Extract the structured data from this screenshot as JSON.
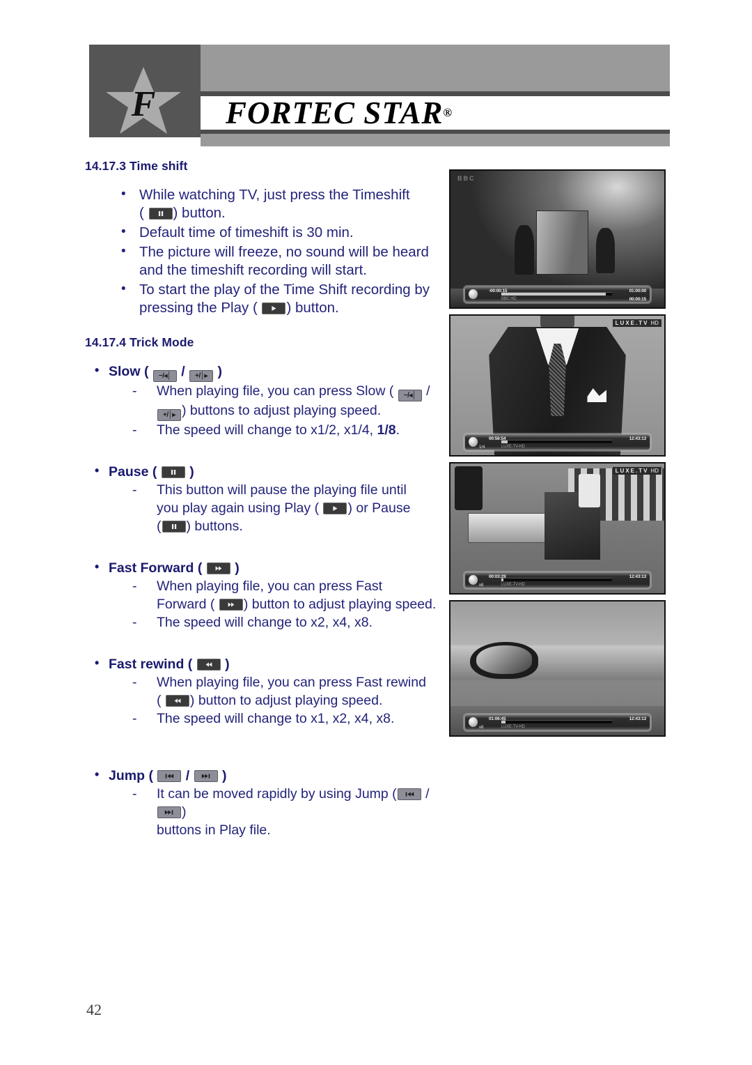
{
  "header": {
    "brand": "FORTEC STAR",
    "registered_mark": "®",
    "logo_letter": "F"
  },
  "sections": [
    {
      "number": "14.17.3",
      "title": "Time shift",
      "heading": "14.17.3 Time shift"
    },
    {
      "number": "14.17.4",
      "title": "Trick Mode",
      "heading": "14.17.4 Trick Mode"
    }
  ],
  "timeshift_bullets": {
    "b1_a": "While watching TV, just press the Timeshift",
    "b1_b1": "(",
    "b1_b2": ") button.",
    "b2": "Default time of timeshift is 30 min.",
    "b3_a": "The picture will freeze, no sound will be heard",
    "b3_b": "and the timeshift recording will start.",
    "b4_a": "To start the play of the Time Shift recording by",
    "b4_b1": "pressing the Play (",
    "b4_b2": ") button."
  },
  "trick": {
    "slow": {
      "label": "Slow",
      "paren_open": "(",
      "slash": "/",
      "paren_close": ")",
      "d1_a": "When playing file, you can press Slow (",
      "d1_slash": "/",
      "d1_b": ") buttons to adjust playing speed.",
      "d2_a": "The speed will change to x1/2, x1/4, ",
      "d2_bold": "1/8",
      "d2_b": "."
    },
    "pause": {
      "label": "Pause",
      "paren_open": "(",
      "paren_close": ")",
      "d1_a": "This button will pause the playing file until",
      "d1_b1": "you play again using Play (",
      "d1_b2": ") or Pause",
      "d1_c1": "(",
      "d1_c2": ") buttons."
    },
    "fast_forward": {
      "label": "Fast Forward",
      "paren_open": "(",
      "paren_close": ")",
      "d1_a": "When playing file, you can press Fast",
      "d1_b1": "Forward (",
      "d1_b2": ") button to adjust playing speed.",
      "d2": "The speed will change to x2, x4, x8."
    },
    "fast_rewind": {
      "label": "Fast rewind",
      "paren_open": "(",
      "paren_close": ")",
      "d1_a": "When playing file, you can press Fast rewind",
      "d1_b1": "(",
      "d1_b2": ") button to adjust playing speed.",
      "d2": "The speed will change to x1, x2, x4, x8."
    },
    "jump": {
      "label": "Jump",
      "paren_open": "(",
      "slash": "/",
      "paren_close": ")",
      "d1_a": "It can be moved rapidly by using Jump (",
      "d1_slash": "/",
      "d1_b": ")",
      "d2": "buttons in Play file."
    }
  },
  "keys": {
    "pause": "pause-key",
    "play": "play-key",
    "slow_minus": "−/◂│",
    "slow_plus": "+/│▸",
    "fast_forward": "fast-forward-key",
    "fast_rewind": "fast-rewind-key",
    "jump_back": "jump-back-key",
    "jump_forward": "jump-forward-key"
  },
  "screenshots": [
    {
      "name": "timeshift-osd-screenshot",
      "channel_logo": "BBC",
      "osd": {
        "mode": "",
        "time_left": "-00:00:15",
        "channel": "BBC HD",
        "time_right_top": "01:00:00",
        "time_right_bottom": "00:00:15",
        "progress_percent": 94
      }
    },
    {
      "name": "slow-mode-screenshot",
      "channel_logo": "LUXE.TV",
      "channel_logo_hd": "HD",
      "osd": {
        "mode": "1/4",
        "time_left": "00:56:54",
        "channel": "LUXE-TV-HD",
        "time_right_top": "12:43:13",
        "progress_percent": 6
      }
    },
    {
      "name": "fast-forward-mode-screenshot",
      "channel_logo": "LUXE.TV",
      "channel_logo_hd": "HD",
      "osd": {
        "mode": "x8",
        "time_left": "00:03:29",
        "channel": "LUXE-TV-HD",
        "time_right_top": "12:43:13",
        "progress_percent": 2
      }
    },
    {
      "name": "jump-mode-screenshot",
      "channel_logo": "",
      "osd": {
        "mode": "x8",
        "time_left": "01:06:45",
        "channel": "LUXE-TV-HD",
        "time_right_top": "12:43:13",
        "progress_percent": 4
      }
    }
  ],
  "footer": {
    "page_number": "42"
  },
  "colors": {
    "text_blue": "#23237a",
    "heading_blue": "#1a1a6e",
    "banner_grey": "#9a9a9a",
    "banner_rule": "#4d4d4d",
    "logo_box": "#555555",
    "star": "#ababab"
  }
}
